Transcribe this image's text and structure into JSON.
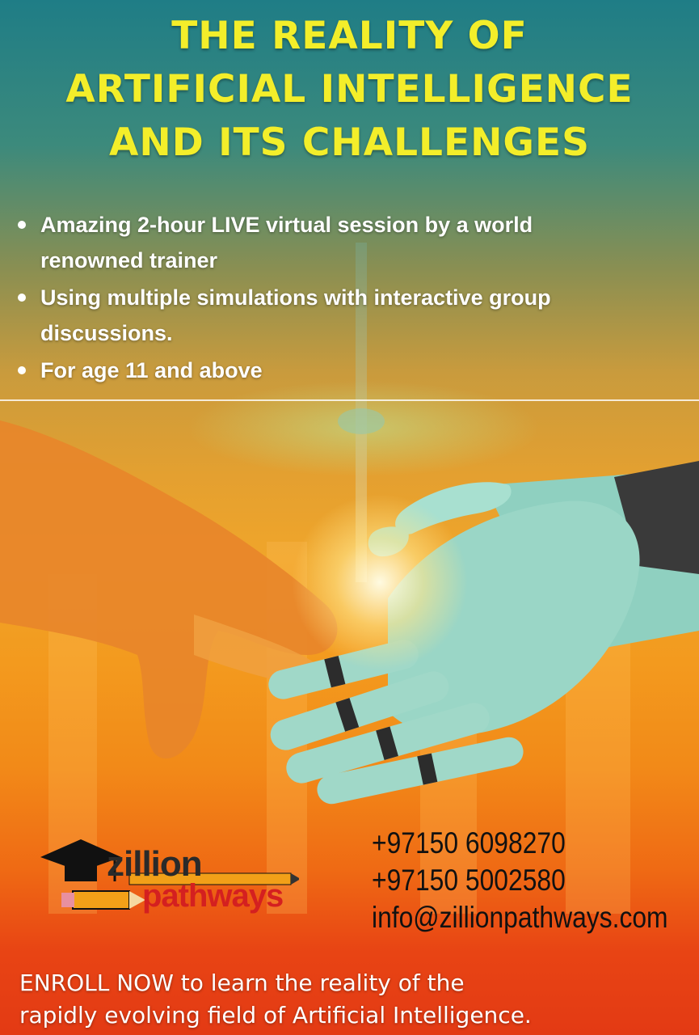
{
  "title": {
    "line1": "THE REALITY OF",
    "line2": "ARTIFICIAL INTELLIGENCE",
    "line3": "AND ITS CHALLENGES"
  },
  "bullets": [
    {
      "line1": "Amazing 2-hour LIVE virtual session by  a world",
      "line2": "renowned trainer"
    },
    {
      "line1": "Using multiple simulations with interactive group",
      "line2": "discussions."
    },
    {
      "line1": "For age 11 and above",
      "line2": ""
    }
  ],
  "logo": {
    "word1": "zillion",
    "word2": "pathways"
  },
  "contact": {
    "phone1": "+97150 6098270",
    "phone2": "+97150 5002580",
    "email": "info@zillionpathways.com"
  },
  "cta": {
    "line1": "ENROLL NOW to learn the reality of the",
    "line2": "rapidly evolving field of Artificial Intelligence."
  },
  "colors": {
    "title": "#f3ee2a",
    "logo_red": "#d42020"
  }
}
